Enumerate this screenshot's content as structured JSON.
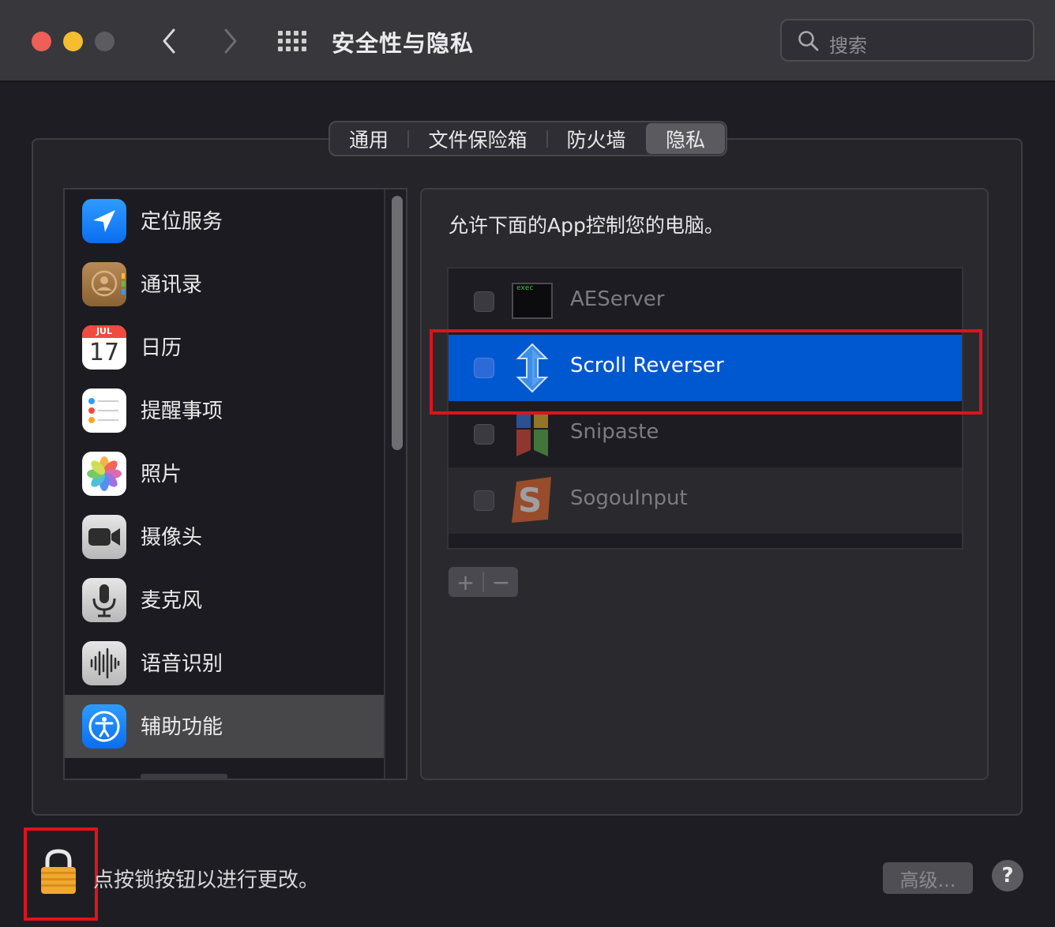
{
  "window": {
    "title": "安全性与隐私",
    "search_placeholder": "搜索"
  },
  "tabs": [
    {
      "label": "通用"
    },
    {
      "label": "文件保险箱"
    },
    {
      "label": "防火墙"
    },
    {
      "label": "隐私",
      "active": true
    }
  ],
  "sidebar": {
    "items": [
      {
        "label": "定位服务",
        "icon": "location-arrow-icon"
      },
      {
        "label": "通讯录",
        "icon": "contacts-icon"
      },
      {
        "label": "日历",
        "icon": "calendar-icon",
        "month": "JUL",
        "day": "17"
      },
      {
        "label": "提醒事项",
        "icon": "reminders-icon"
      },
      {
        "label": "照片",
        "icon": "photos-icon"
      },
      {
        "label": "摄像头",
        "icon": "camera-icon"
      },
      {
        "label": "麦克风",
        "icon": "microphone-icon"
      },
      {
        "label": "语音识别",
        "icon": "speech-recognition-icon"
      },
      {
        "label": "辅助功能",
        "icon": "accessibility-icon",
        "selected": true
      }
    ]
  },
  "main": {
    "heading": "允许下面的App控制您的电脑。",
    "apps": [
      {
        "name": "AEServer",
        "checked": false,
        "icon": "exec-terminal-icon",
        "icon_text": "exec"
      },
      {
        "name": "Scroll Reverser",
        "checked": false,
        "selected": true,
        "icon": "scroll-reverser-icon"
      },
      {
        "name": "Snipaste",
        "checked": false,
        "icon": "snipaste-icon"
      },
      {
        "name": "SogouInput",
        "checked": false,
        "icon": "sogou-input-icon"
      }
    ],
    "add_label": "+",
    "remove_label": "−"
  },
  "footer": {
    "lock_text": "点按锁按钮以进行更改。",
    "advanced_label": "高级...",
    "help_label": "?"
  },
  "colors": {
    "selection_blue": "#0058d0",
    "annotation_red": "#e0121d",
    "close": "#ed5f57",
    "minimize": "#f5be2e",
    "zoom_inactive": "#5c5b60"
  }
}
